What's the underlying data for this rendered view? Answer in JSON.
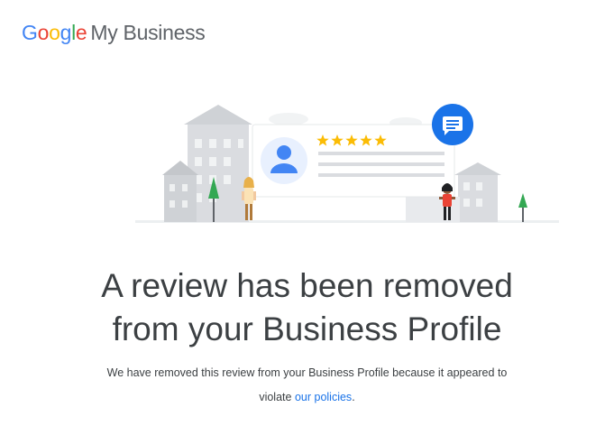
{
  "header": {
    "logo_letters": [
      "G",
      "o",
      "o",
      "g",
      "l",
      "e"
    ],
    "product": "My Business"
  },
  "illustration": {
    "rating_stars": 5,
    "star_color": "#FBBC05",
    "accent_color": "#1a73e8"
  },
  "main": {
    "title_line1": "A review has been removed",
    "title_line2": "from your Business Profile",
    "body_line1": "We have removed this review from your Business Profile because it appeared to",
    "body_prefix": "violate",
    "policies_link": "our policies",
    "body_suffix": "."
  },
  "colors": {
    "google_blue": "#4285F4",
    "google_red": "#EA4335",
    "google_yellow": "#FBBC05",
    "google_green": "#34A853",
    "link": "#1a73e8",
    "text": "#3c4043"
  }
}
